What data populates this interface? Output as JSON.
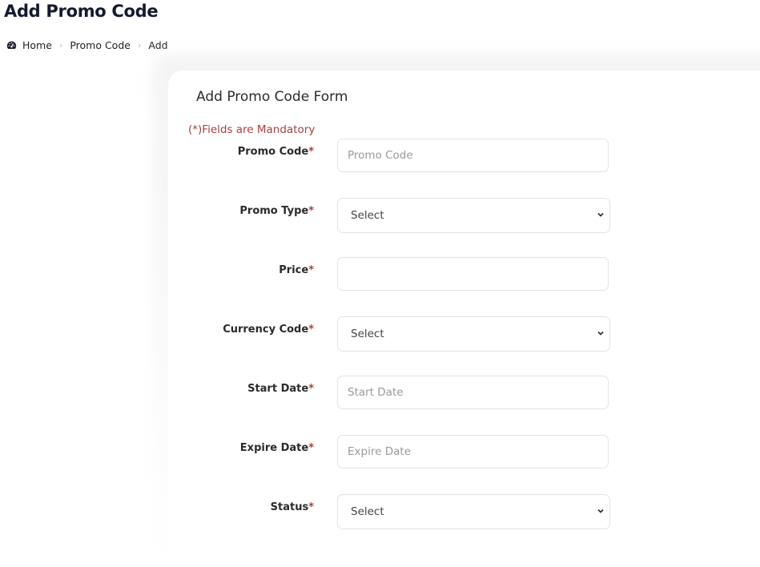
{
  "page": {
    "title": "Add Promo Code"
  },
  "breadcrumb": {
    "icon": "dashboard-icon",
    "items": [
      "Home",
      "Promo Code",
      "Add"
    ],
    "separator": "›"
  },
  "form": {
    "title": "Add Promo Code Form",
    "mandatory_note": "(*)Fields are Mandatory",
    "required_marker": "*",
    "fields": [
      {
        "label": "Promo Code",
        "type": "text",
        "value": "",
        "placeholder": "Promo Code"
      },
      {
        "label": "Promo Type",
        "type": "select",
        "selected": "Select"
      },
      {
        "label": "Price",
        "type": "text",
        "value": "",
        "placeholder": ""
      },
      {
        "label": "Currency Code",
        "type": "select",
        "selected": "Select"
      },
      {
        "label": "Start Date",
        "type": "text",
        "value": "",
        "placeholder": "Start Date"
      },
      {
        "label": "Expire Date",
        "type": "text",
        "value": "",
        "placeholder": "Expire Date"
      },
      {
        "label": "Status",
        "type": "select",
        "selected": "Select"
      }
    ]
  },
  "colors": {
    "required": "#a8413f",
    "title": "#141a2e",
    "border": "#e3e3e3"
  }
}
